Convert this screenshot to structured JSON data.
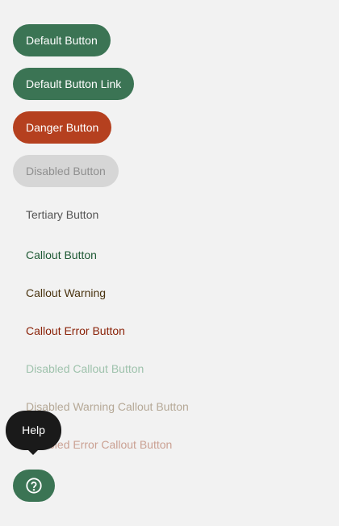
{
  "buttons": {
    "default": "Default Button",
    "default_link": "Default Button Link",
    "danger": "Danger Button",
    "disabled": "Disabled Button",
    "tertiary": "Tertiary Button",
    "callout": "Callout Button",
    "callout_warning": "Callout Warning",
    "callout_error": "Callout Error Button",
    "disabled_callout": "Disabled Callout Button",
    "disabled_warning_callout": "Disabled Warning Callout Button",
    "disabled_error_callout": "Disabled Error Callout Button"
  },
  "help": {
    "tooltip": "Help",
    "icon": "question-circle-icon"
  },
  "colors": {
    "primary": "#3b7454",
    "danger": "#b5401f",
    "disabled_bg": "#d6d6d6",
    "background": "#f2f2f2"
  }
}
